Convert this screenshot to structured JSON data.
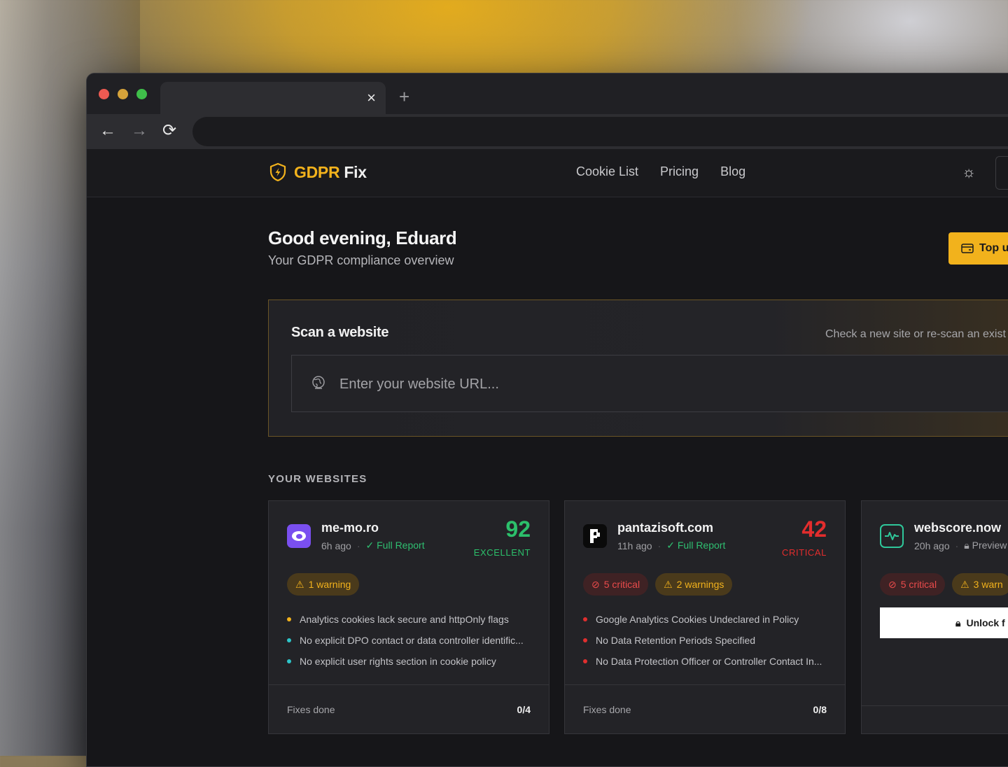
{
  "browser": {
    "tab_close": "×",
    "new_tab": "+",
    "back": "←",
    "forward": "→",
    "reload": "⟳"
  },
  "header": {
    "logo_part1": "GDPR",
    "logo_part2": "Fix",
    "nav": [
      "Cookie List",
      "Pricing",
      "Blog"
    ],
    "theme_icon": "☼"
  },
  "greeting": {
    "title": "Good evening, Eduard",
    "subtitle": "Your GDPR compliance overview"
  },
  "topup": {
    "label": "Top u"
  },
  "scan": {
    "title": "Scan a website",
    "hint": "Check a new site or re-scan an exist",
    "placeholder": "Enter your website URL..."
  },
  "websites": {
    "section_label": "YOUR WEBSITES",
    "cards": [
      {
        "name": "me-mo.ro",
        "time": "6h ago",
        "report": "Full Report",
        "score": "92",
        "score_label": "EXCELLENT",
        "badges": [
          "1 warning"
        ],
        "issues": [
          "Analytics cookies lack secure and httpOnly flags",
          "No explicit DPO contact or data controller identific...",
          "No explicit user rights section in cookie policy"
        ],
        "fixes_label": "Fixes done",
        "fixes_value": "0/4"
      },
      {
        "name": "pantazisoft.com",
        "time": "11h ago",
        "report": "Full Report",
        "score": "42",
        "score_label": "CRITICAL",
        "badges": [
          "5 critical",
          "2 warnings"
        ],
        "issues": [
          "Google Analytics Cookies Undeclared in Policy",
          "No Data Retention Periods Specified",
          "No Data Protection Officer or Controller Contact In..."
        ],
        "fixes_label": "Fixes done",
        "fixes_value": "0/8"
      },
      {
        "name": "webscore.now",
        "time": "20h ago",
        "report": "Preview",
        "badges": [
          "5 critical",
          "3 warn"
        ],
        "unlock": "Unlock f"
      }
    ]
  },
  "colors": {
    "accent": "#f2b21c",
    "excellent": "#2cc06b",
    "critical": "#e32d2d"
  }
}
